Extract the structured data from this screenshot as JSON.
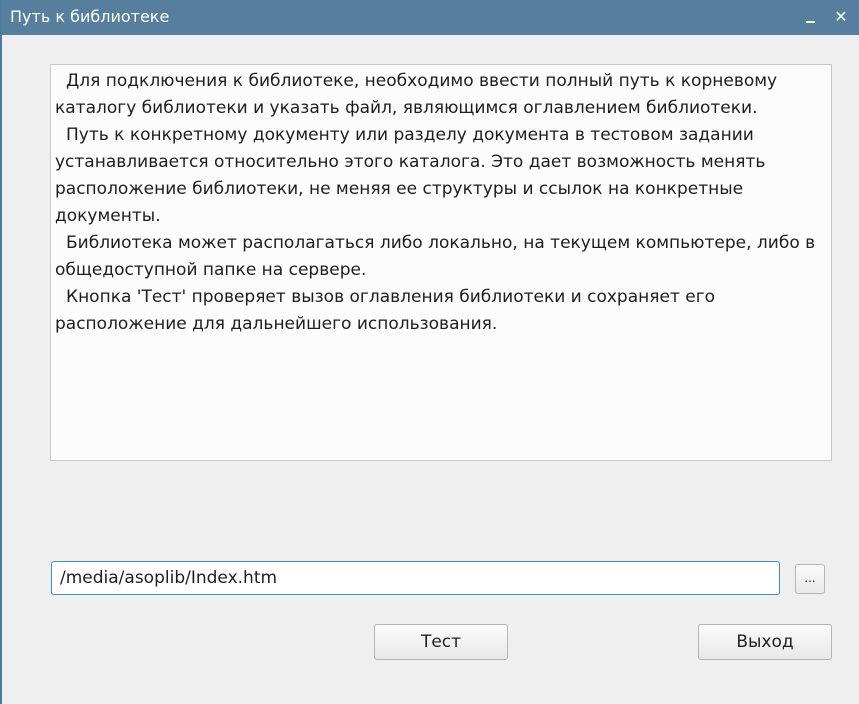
{
  "window": {
    "title": "Путь к библиотеке",
    "minimize_glyph": "_",
    "close_glyph": "✕"
  },
  "description": {
    "paragraphs": [
      "Для подключения к библиотеке, необходимо ввести полный путь к корневому каталогу библиотеки и указать файл, являющимся оглавлением библиотеки.",
      "Путь к конкретному документу или разделу документа в тестовом задании устанавливается относительно этого каталога. Это дает возможность менять расположение библиотеки, не меняя ее структуры и ссылок на конкретные документы.",
      "Библиотека может располагаться либо локально, на текущем компьютере, либо в общедоступной папке на сервере.",
      "Кнопка 'Тест' проверяет вызов оглавления библиотеки и сохраняет его расположение для дальнейшего использования."
    ]
  },
  "path": {
    "value": "/media/asoplib/Index.htm"
  },
  "buttons": {
    "browse": "...",
    "test": "Тест",
    "exit": "Выход"
  },
  "colors": {
    "titlebar": "#567f9d",
    "input_focus_border": "#3e8ed6"
  }
}
